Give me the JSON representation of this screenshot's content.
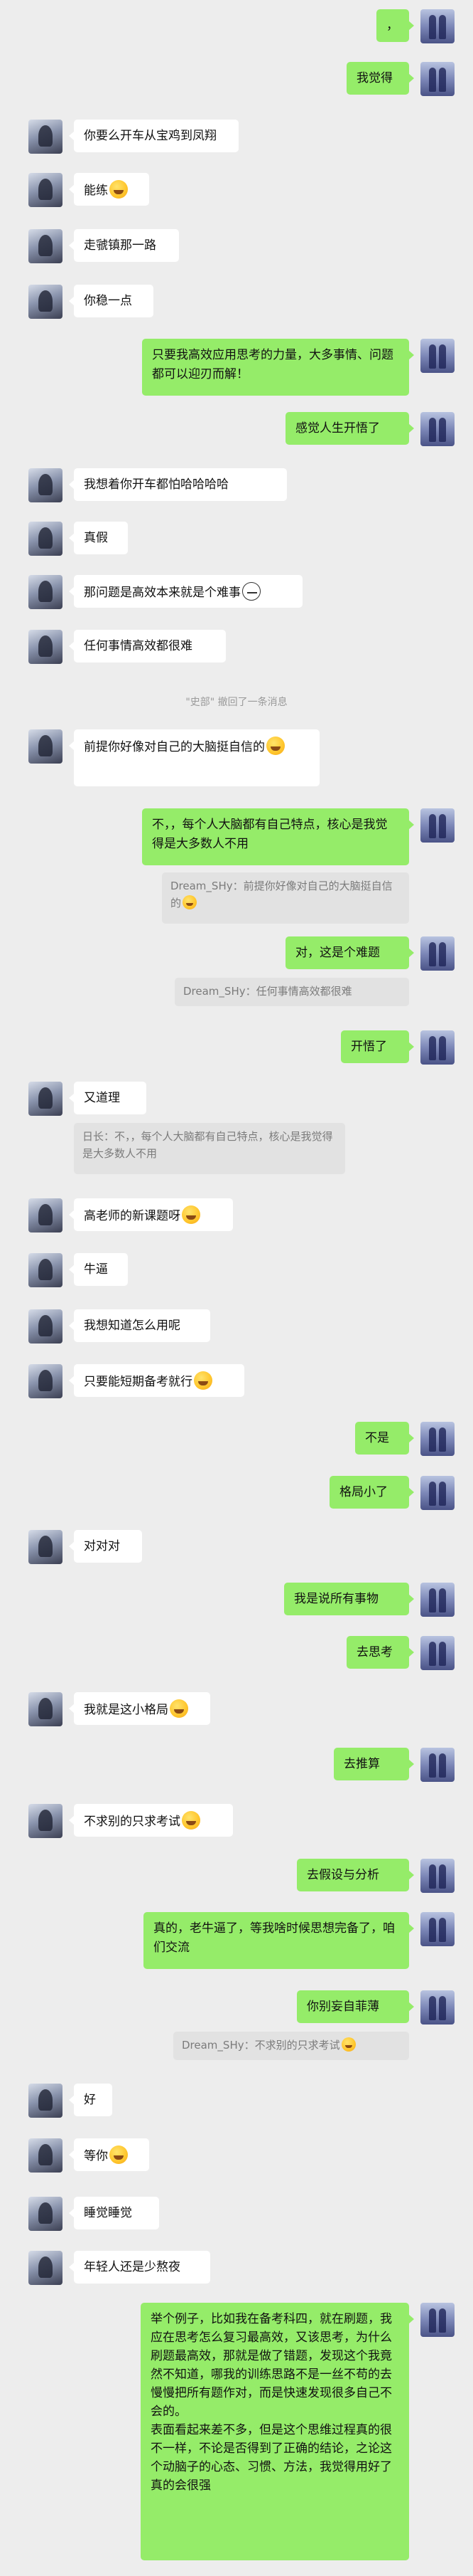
{
  "messages": [
    {
      "side": "right",
      "text": "，"
    },
    {
      "side": "right",
      "text": "我觉得"
    },
    {
      "side": "left",
      "text": "你要么开车从宝鸡到凤翔"
    },
    {
      "side": "left",
      "text": "能练",
      "emoji": "grin-emoji"
    },
    {
      "side": "left",
      "text": "走虢镇那一路"
    },
    {
      "side": "left",
      "text": "你稳一点"
    },
    {
      "side": "right",
      "text": "只要我高效应用思考的力量，大多事情、问题都可以迎刃而解！"
    },
    {
      "side": "right",
      "text": "感觉人生开悟了"
    },
    {
      "side": "left",
      "text": "我想着你开车都怕哈哈哈哈"
    },
    {
      "side": "left",
      "text": "真假"
    },
    {
      "side": "left",
      "text": "那问题是高效本来就是个难事",
      "emoji": "neutral-face-emoji"
    },
    {
      "side": "left",
      "text": "任何事情高效都很难"
    },
    {
      "system": "\"史部\" 撤回了一条消息"
    },
    {
      "side": "left",
      "text": "前提你好像对自己的大脑挺自信的",
      "emoji": "cat-grin-emoji"
    },
    {
      "side": "right",
      "text": "不，，每个人大脑都有自己特点，核心是我觉得是大多数人不用",
      "quote": "Dream_SHy：前提你好像对自己的大脑挺自信的"
    },
    {
      "side": "right",
      "text": "对，这是个难题",
      "quote": "Dream_SHy：任何事情高效都很难"
    },
    {
      "side": "right",
      "text": "开悟了"
    },
    {
      "side": "left",
      "text": "又道理",
      "quote": "日长：不，，每个人大脑都有自己特点，核心是我觉得是大多数人不用"
    },
    {
      "side": "left",
      "text": "高老师的新课题呀",
      "emoji": "drool-emoji"
    },
    {
      "side": "left",
      "text": "牛逼"
    },
    {
      "side": "left",
      "text": "我想知道怎么用呢"
    },
    {
      "side": "left",
      "text": "只要能短期备考就行",
      "emoji": "cat-grin-emoji"
    },
    {
      "side": "right",
      "text": "不是"
    },
    {
      "side": "right",
      "text": "格局小了"
    },
    {
      "side": "left",
      "text": "对对对"
    },
    {
      "side": "right",
      "text": "我是说所有事物"
    },
    {
      "side": "right",
      "text": "去思考"
    },
    {
      "side": "left",
      "text": "我就是这小格局",
      "emoji": "grin-emoji"
    },
    {
      "side": "right",
      "text": "去推算"
    },
    {
      "side": "left",
      "text": "不求别的只求考试",
      "emoji": "grin-emoji"
    },
    {
      "side": "right",
      "text": "去假设与分析"
    },
    {
      "side": "right",
      "text": "真的，老牛逼了，等我啥时候思想完备了，咱们交流"
    },
    {
      "side": "right",
      "text": "你别妄自菲薄",
      "quote": "Dream_SHy：不求别的只求考试",
      "quote_emoji": "grin-emoji"
    },
    {
      "side": "left",
      "text": "好"
    },
    {
      "side": "left",
      "text": "等你",
      "emoji": "grin-emoji"
    },
    {
      "side": "left",
      "text": "睡觉睡觉"
    },
    {
      "side": "left",
      "text": "年轻人还是少熬夜"
    },
    {
      "side": "right",
      "text": "举个例子，比如我在备考科四，就在刷题，我应在思考怎么复习最高效，又该思考，为什么刷题最高效，那就是做了错题，发现这个我竟然不知道，哪我的训练思路不是一丝不苟的去慢慢把所有题作对，而是快速发现很多自己不会的。\n表面看起来差不多，但是这个思维过程真的很不一样，不论是否得到了正确的结论，之论这个动脑子的心态、习惯、方法，我觉得用好了真的会很强"
    }
  ]
}
